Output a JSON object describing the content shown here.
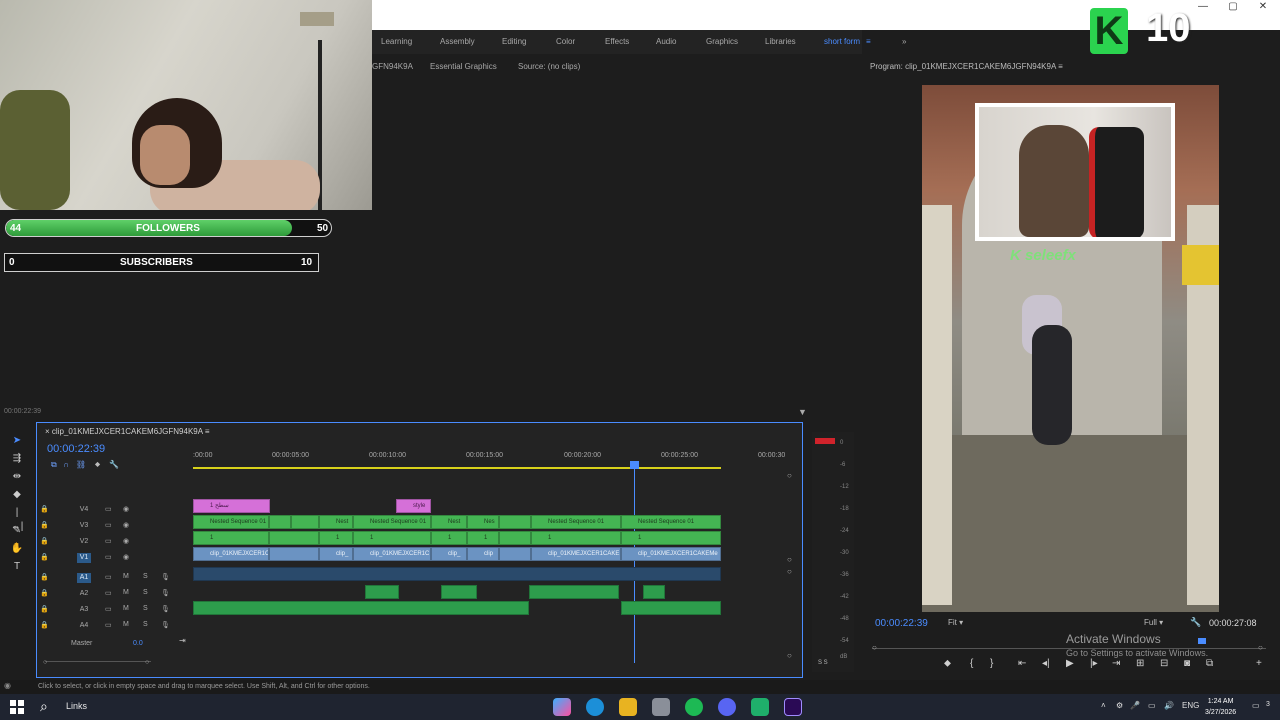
{
  "workspace_tabs": [
    "Learning",
    "Assembly",
    "Editing",
    "Color",
    "Effects",
    "Audio",
    "Graphics",
    "Libraries",
    "short form"
  ],
  "active_tab_index": 8,
  "panel_tabs": {
    "partial_left": "GFN94K9A",
    "essential_graphics": "Essential Graphics",
    "source": "Source: (no clips)"
  },
  "overlay": {
    "followers": {
      "label": "FOLLOWERS",
      "current": "44",
      "goal": "50",
      "progress": 0.88
    },
    "subscribers": {
      "label": "SUBSCRIBERS",
      "current": "0",
      "goal": "10"
    },
    "logo_letter": "K",
    "logo_number": "10",
    "game_brand": "K seleefx"
  },
  "program": {
    "title": "Program: clip_01KMEJXCER1CAKEM6JGFN94K9A",
    "timecode": "00:00:22:39",
    "fit": "Fit",
    "quality": "Full",
    "duration": "00:00:27:08"
  },
  "left_panel_time": "00:00:22:39",
  "timeline": {
    "sequence_tab": "clip_01KMEJXCER1CAKEM6JGFN94K9A",
    "timecode": "00:00:22:39",
    "ruler": [
      ":00:00",
      "00:00:05:00",
      "00:00:10:00",
      "00:00:15:00",
      "00:00:20:00",
      "00:00:25:00",
      "00:00:30"
    ],
    "video_tracks": [
      "V4",
      "V3",
      "V2",
      "V1"
    ],
    "audio_tracks": [
      "A1",
      "A2",
      "A3",
      "A4"
    ],
    "master": {
      "label": "Master",
      "value": "0.0"
    },
    "clips": {
      "v4a": "1 سطح",
      "v4b": "style",
      "nested": "Nested Sequence 01",
      "nest_short": "Nest",
      "nes_short": "Nes",
      "one": "1",
      "clip_v1": "clip_01KMEJXCER1C",
      "clip_v1b": "clip_",
      "clip_v1c": "clip_01KMEJXCER1C",
      "clip_v1d": "clip_",
      "clip_v1e": "clip",
      "clip_v1f": "clip_01KMEJXCER1CAKE",
      "clip_v1g": "clip_01KMEJXCER1CAKEMe"
    },
    "meter_db": [
      "0",
      "-6",
      "-12",
      "-18",
      "-24",
      "-30",
      "-36",
      "-42",
      "-48",
      "-54",
      "dB"
    ],
    "meter_ss": "S S"
  },
  "windows": {
    "activate_title": "Activate Windows",
    "activate_sub": "Go to Settings to activate Windows."
  },
  "status_bar": "Click to select, or click in empty space and drag to marquee select. Use Shift, Alt, and Ctrl for other options.",
  "taskbar": {
    "links": "Links",
    "lang": "ENG",
    "time": "1:24 AM",
    "date": "3/27/2026",
    "notif": "3"
  },
  "colors": {
    "accent": "#4a8cff",
    "green": "#44b553",
    "pink": "#d570d8",
    "blue": "#6b93c2"
  }
}
